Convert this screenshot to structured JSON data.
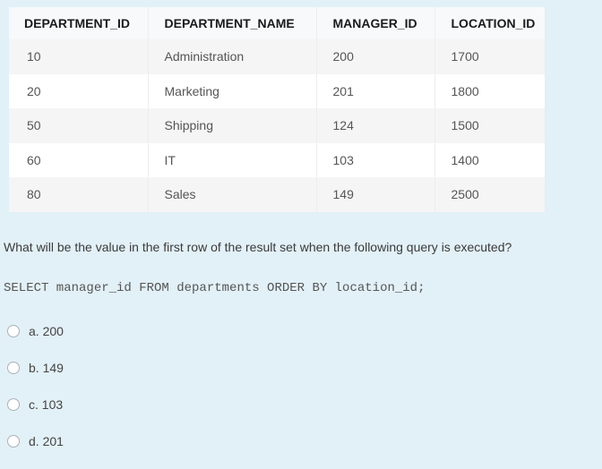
{
  "table": {
    "headers": [
      "DEPARTMENT_ID",
      "DEPARTMENT_NAME",
      "MANAGER_ID",
      "LOCATION_ID"
    ],
    "rows": [
      [
        "10",
        "Administration",
        "200",
        "1700"
      ],
      [
        "20",
        "Marketing",
        "201",
        "1800"
      ],
      [
        "50",
        "Shipping",
        "124",
        "1500"
      ],
      [
        "60",
        "IT",
        "103",
        "1400"
      ],
      [
        "80",
        "Sales",
        "149",
        "2500"
      ]
    ]
  },
  "question": "What will be the value in the first row of the result set when the following query is executed?",
  "sql": "SELECT manager_id FROM departments ORDER BY location_id;",
  "options": [
    {
      "label": "a. 200",
      "selected": false
    },
    {
      "label": "b. 149",
      "selected": false
    },
    {
      "label": "c. 103",
      "selected": false
    },
    {
      "label": "d. 201",
      "selected": false
    }
  ]
}
